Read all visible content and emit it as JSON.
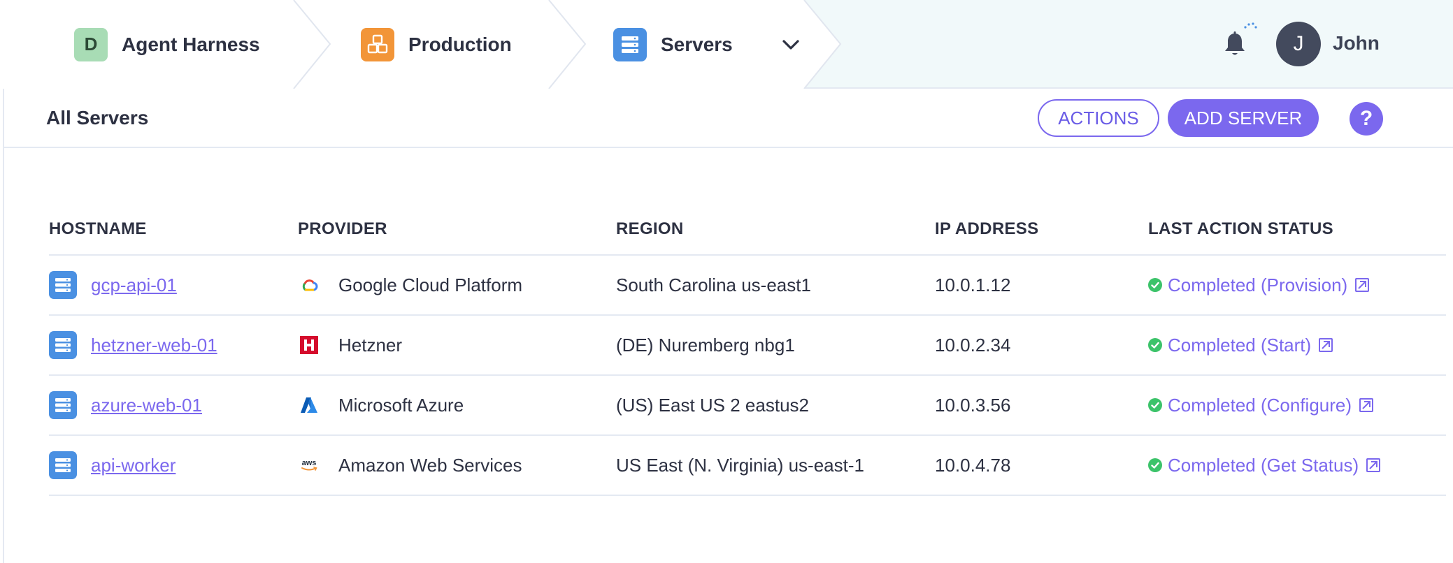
{
  "breadcrumb": [
    {
      "label": "Agent Harness",
      "badge": "D",
      "badge_color": "#a8dcb5"
    },
    {
      "label": "Production",
      "badge_color": "#f29538",
      "icon": "cubes-icon"
    },
    {
      "label": "Servers",
      "badge_color": "#4a90e2",
      "icon": "server-icon"
    }
  ],
  "user": {
    "initial": "J",
    "name": "John"
  },
  "subheader": {
    "title": "All Servers",
    "actions_label": "ACTIONS",
    "add_label": "ADD SERVER",
    "help_label": "?"
  },
  "table": {
    "columns": [
      "HOSTNAME",
      "PROVIDER",
      "REGION",
      "IP ADDRESS",
      "LAST ACTION STATUS"
    ],
    "rows": [
      {
        "hostname": "gcp-api-01",
        "provider": "Google Cloud Platform",
        "provider_icon": "gcp-icon",
        "region": "South Carolina us-east1",
        "ip": "10.0.1.12",
        "status": "Completed (Provision)"
      },
      {
        "hostname": "hetzner-web-01",
        "provider": "Hetzner",
        "provider_icon": "hetzner-icon",
        "region": "(DE) Nuremberg nbg1",
        "ip": "10.0.2.34",
        "status": "Completed (Start)"
      },
      {
        "hostname": "azure-web-01",
        "provider": "Microsoft Azure",
        "provider_icon": "azure-icon",
        "region": "(US) East US 2 eastus2",
        "ip": "10.0.3.56",
        "status": "Completed (Configure)"
      },
      {
        "hostname": "api-worker",
        "provider": "Amazon Web Services",
        "provider_icon": "aws-icon",
        "region": "US East (N. Virginia) us-east-1",
        "ip": "10.0.4.78",
        "status": "Completed (Get Status)"
      }
    ]
  },
  "colors": {
    "accent": "#7b68ee",
    "success": "#3cc36a",
    "server_blue": "#4a90e2"
  }
}
